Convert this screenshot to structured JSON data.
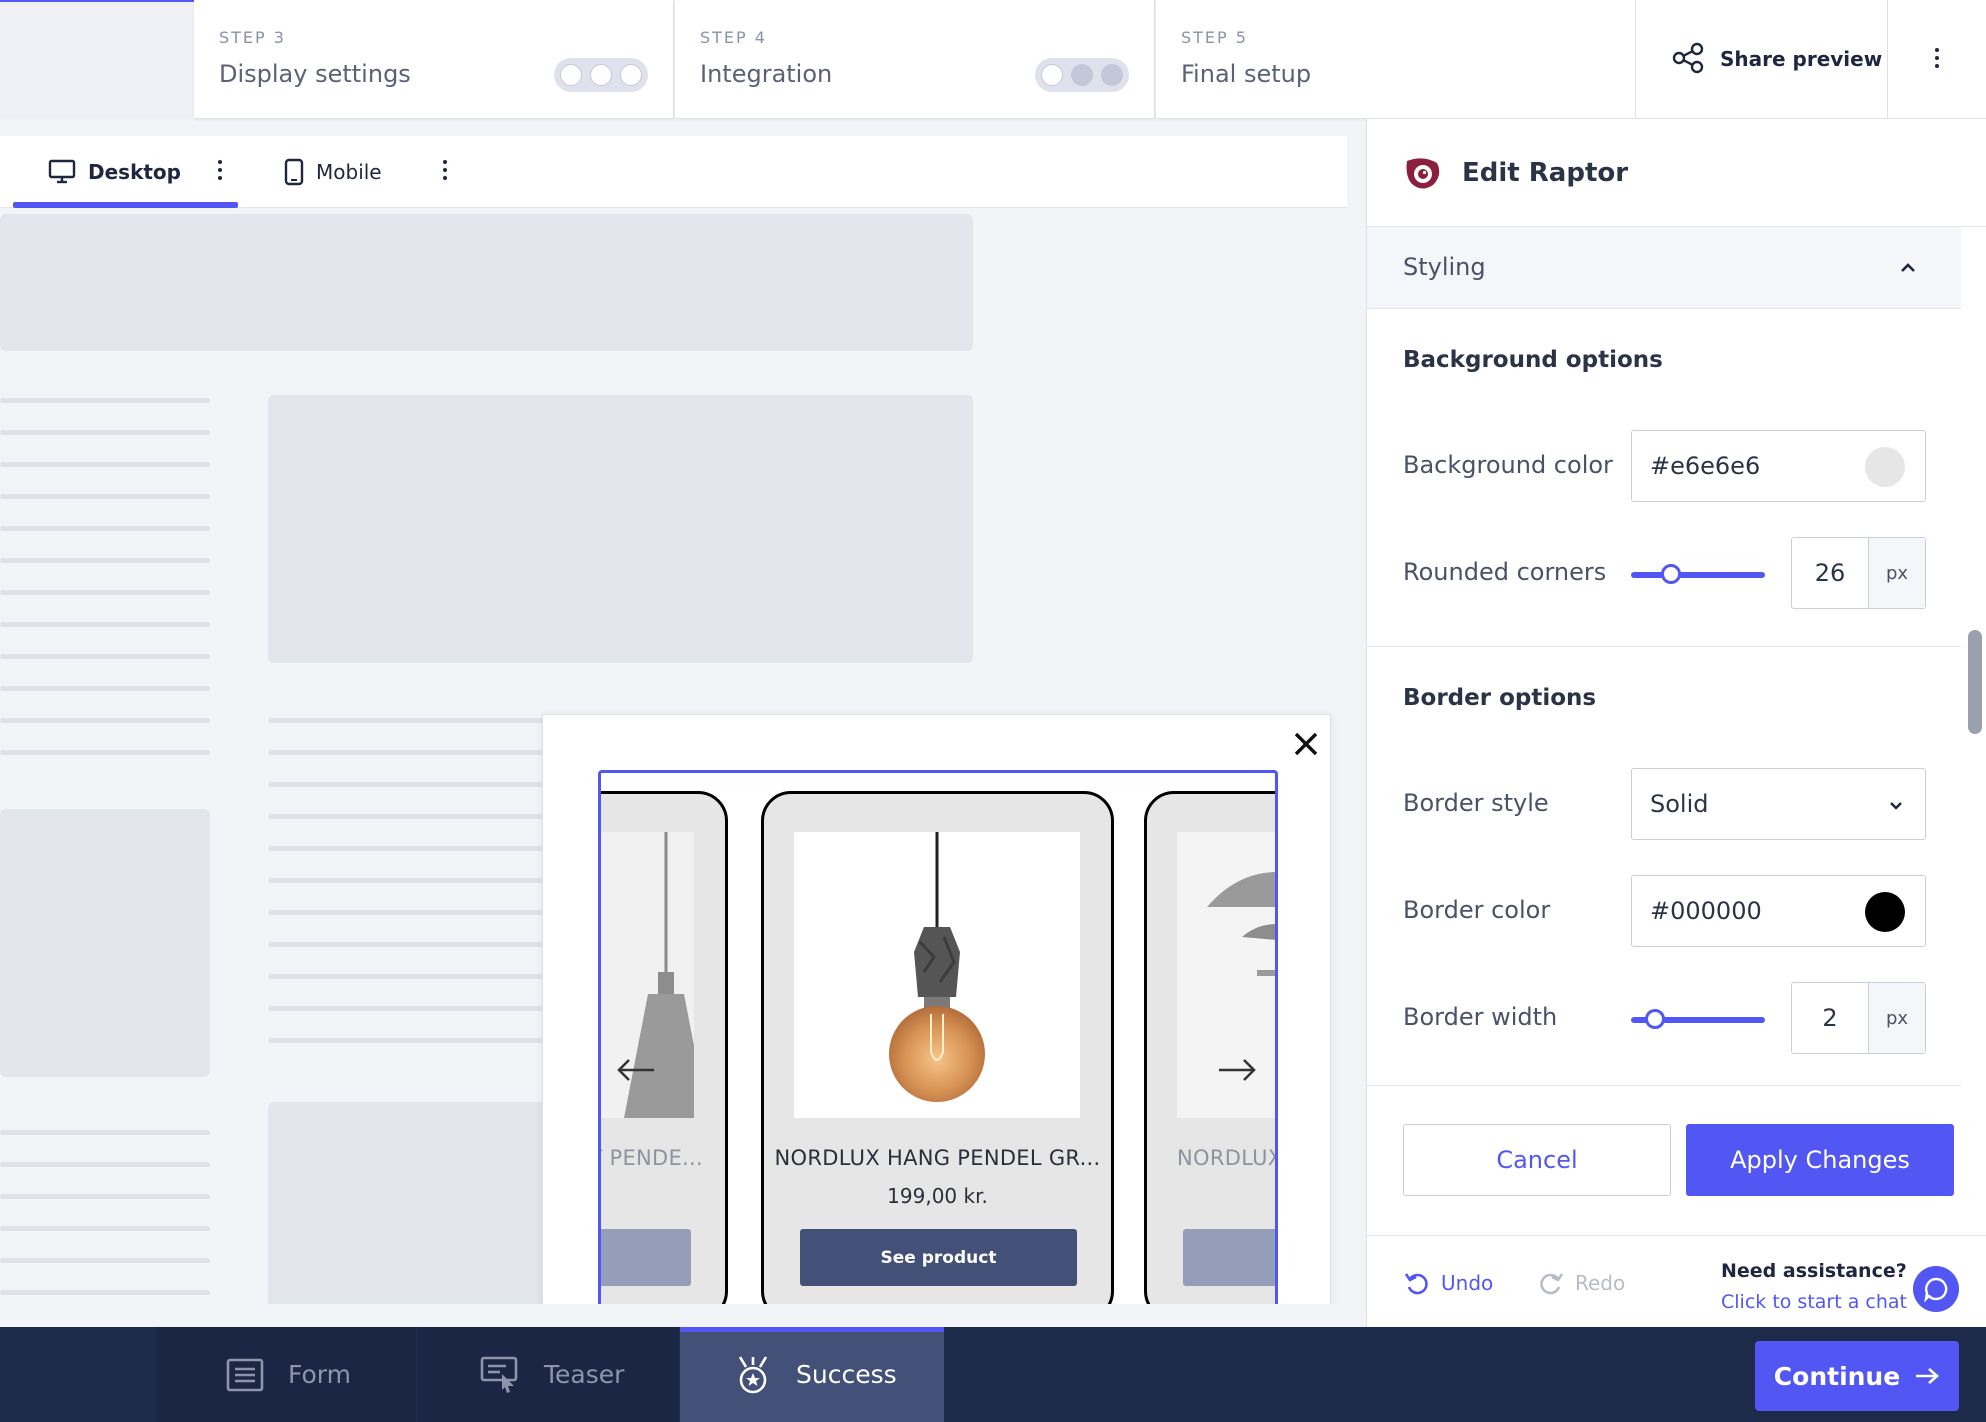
{
  "steps": [
    {
      "num": "STEP 3",
      "title": "Display settings"
    },
    {
      "num": "STEP 4",
      "title": "Integration"
    },
    {
      "num": "STEP 5",
      "title": "Final setup"
    }
  ],
  "share_label": "Share preview",
  "device_tabs": {
    "desktop": "Desktop",
    "mobile": "Mobile"
  },
  "popup": {
    "products": [
      {
        "name": "T PENDE...",
        "price": ""
      },
      {
        "name": "NORDLUX HANG PENDEL GR...",
        "price": "199,00 kr.",
        "button": "See product"
      },
      {
        "name": "NORDLUX",
        "price": ""
      }
    ]
  },
  "panel": {
    "title": "Edit Raptor",
    "accordion": "Styling",
    "background_section": "Background options",
    "background_color_label": "Background color",
    "background_color_value": "#e6e6e6",
    "rounded_label": "Rounded corners",
    "rounded_value": "26",
    "rounded_fraction": 0.26,
    "border_section": "Border options",
    "border_style_label": "Border style",
    "border_style_value": "Solid",
    "border_color_label": "Border color",
    "border_color_value": "#000000",
    "border_width_label": "Border width",
    "border_width_value": "2",
    "border_width_fraction": 0.12,
    "unit": "px",
    "cancel": "Cancel",
    "apply": "Apply Changes",
    "undo": "Undo",
    "redo": "Redo",
    "assist_q": "Need assistance?",
    "assist_link": "Click to start a chat"
  },
  "bottom_tabs": {
    "form": "Form",
    "teaser": "Teaser",
    "success": "Success"
  },
  "continue": "Continue",
  "colors": {
    "accent": "#5257f3",
    "navy": "#1e2a4a",
    "product_button": "#435179"
  }
}
